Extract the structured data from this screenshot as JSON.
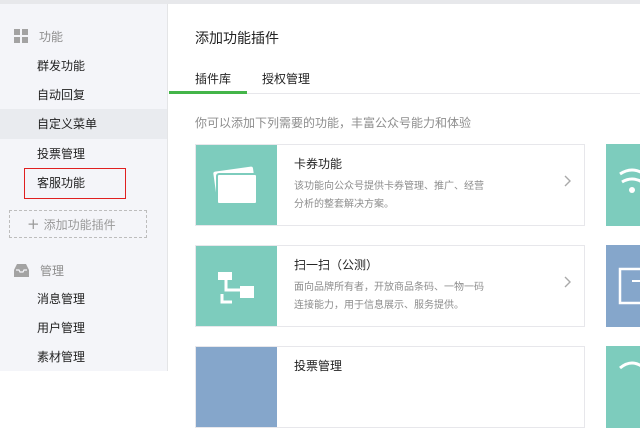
{
  "sidebar": {
    "section1": {
      "icon": "grid-icon",
      "label": "功能"
    },
    "items1": [
      {
        "label": "群发功能"
      },
      {
        "label": "自动回复"
      },
      {
        "label": "自定义菜单"
      },
      {
        "label": "投票管理"
      },
      {
        "label": "客服功能"
      }
    ],
    "add_plugin": "添加功能插件",
    "section2": {
      "icon": "inbox-icon",
      "label": "管理"
    },
    "items2": [
      {
        "label": "消息管理"
      },
      {
        "label": "用户管理"
      },
      {
        "label": "素材管理"
      }
    ]
  },
  "main": {
    "title": "添加功能插件",
    "tabs": [
      {
        "label": "插件库"
      },
      {
        "label": "授权管理"
      }
    ],
    "intro": "你可以添加下列需要的功能，丰富公众号能力和体验",
    "cards": [
      {
        "title": "卡券功能",
        "desc_line1": "该功能向公众号提供卡券管理、推广、经营",
        "desc_line2": "分析的整套解决方案。",
        "icon": "card-icon",
        "color": "#7dccbd"
      },
      {
        "title": "扫一扫（公测）",
        "desc_line1": "面向品牌所有者，开放商品条码、一物一码",
        "desc_line2": "连接能力，用于信息展示、服务提供。",
        "icon": "scan-icon",
        "color": "#7dccbd"
      },
      {
        "title": "投票管理",
        "icon": "vote-icon",
        "color": "#85a6cb"
      }
    ]
  },
  "colors": {
    "accent": "#44b549",
    "highlight": "#e02020",
    "teal": "#7dccbd",
    "blue": "#85a6cb"
  }
}
